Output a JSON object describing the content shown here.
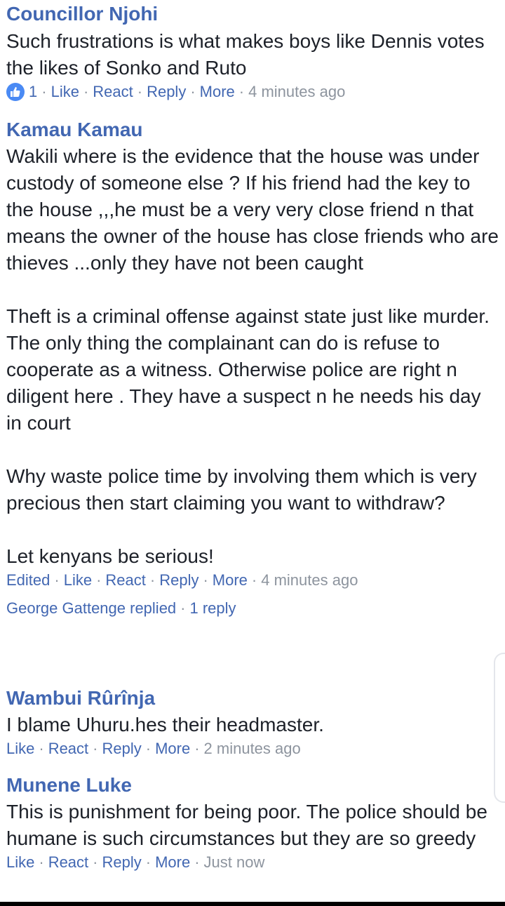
{
  "comments": [
    {
      "author": "Councillor Njohi",
      "text": "Such frustrations is what makes boys like Dennis votes the likes of Sonko and Ruto",
      "reaction_count": "1",
      "actions": {
        "first": "Like",
        "react": "React",
        "reply": "Reply",
        "more": "More"
      },
      "time": "4 minutes ago"
    },
    {
      "author": "Kamau Kamau",
      "text": "Wakili where is the evidence that the house was under custody of someone else ? If his friend had the key to the house ,,,he must be a very very close friend n that means the owner of the house has close friends who are thieves ...only they have not been caught\n\nTheft is a criminal offense against state just like murder. The only thing the complainant can do is refuse to cooperate as a witness. Otherwise police are right n diligent here . They have a suspect n he needs his day in court\n\nWhy waste police time by involving them which is very precious then start claiming you want to withdraw?\n\nLet kenyans be serious!",
      "actions": {
        "edited": "Edited",
        "first": "Like",
        "react": "React",
        "reply": "Reply",
        "more": "More"
      },
      "time": "4 minutes ago",
      "replies": {
        "who": "George Gattenge replied",
        "count": "1 reply"
      }
    },
    {
      "author": "Wambui Rûrînja",
      "text": "I blame Uhuru.hes their headmaster.",
      "actions": {
        "first": "Like",
        "react": "React",
        "reply": "Reply",
        "more": "More"
      },
      "time": "2 minutes ago"
    },
    {
      "author": "Munene Luke",
      "text": "This is punishment for being poor. The police should be humane is such circumstances but they are so greedy",
      "actions": {
        "first": "Like",
        "react": "React",
        "reply": "Reply",
        "more": "More"
      },
      "time": "Just now"
    }
  ],
  "colors": {
    "author": "#4267b2",
    "body": "#1d2129",
    "meta_gray": "#8d949e",
    "like_badge": "#4a8af4"
  },
  "icons": {
    "reaction": "thumbs-up-icon"
  }
}
